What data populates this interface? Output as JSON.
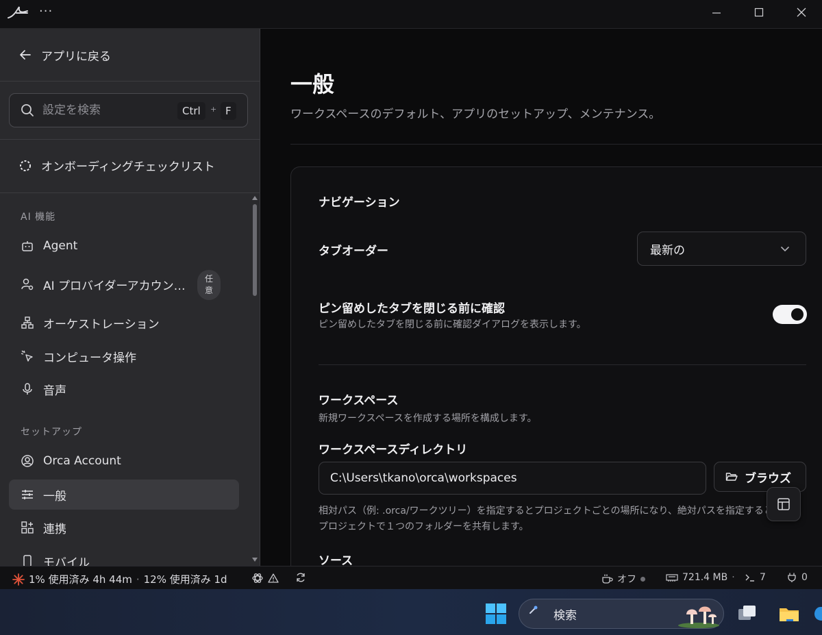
{
  "titlebar": {
    "menu_glyph": "···"
  },
  "sidebar": {
    "back_label": "アプリに戻る",
    "search": {
      "placeholder": "設定を検索",
      "key_ctrl": "Ctrl",
      "key_plus": "+",
      "key_f": "F"
    },
    "onboarding_label": "オンボーディングチェックリスト",
    "sections": [
      {
        "title": "AI 機能"
      },
      {
        "title": "セットアップ"
      }
    ],
    "items": [
      {
        "label": "Agent",
        "icon": "bot-icon"
      },
      {
        "label": "AI プロバイダーアカウン…",
        "icon": "user-gear-icon",
        "badge_line1": "任",
        "badge_line2": "意"
      },
      {
        "label": "オーケストレーション",
        "icon": "hierarchy-icon"
      },
      {
        "label": "コンピュータ操作",
        "icon": "cursor-click-icon"
      },
      {
        "label": "音声",
        "icon": "microphone-icon"
      },
      {
        "label": "Orca Account",
        "icon": "user-circle-icon"
      },
      {
        "label": "一般",
        "icon": "sliders-icon",
        "active": true
      },
      {
        "label": "連携",
        "icon": "grid-plus-icon"
      },
      {
        "label": "モバイル",
        "icon": "phone-icon"
      }
    ]
  },
  "main": {
    "title": "一般",
    "subtitle": "ワークスペースのデフォルト、アプリのセットアップ、メンテナンス。",
    "navigation": {
      "heading": "ナビゲーション",
      "tab_order_label": "タブオーダー",
      "tab_order_value": "最新の",
      "confirm_label": "ピン留めしたタブを閉じる前に確認",
      "confirm_desc": "ピン留めしたタブを閉じる前に確認ダイアログを表示します。",
      "confirm_enabled": true
    },
    "workspace": {
      "heading": "ワークスペース",
      "desc": "新規ワークスペースを作成する場所を構成します。",
      "dir_label": "ワークスペースディレクトリ",
      "dir_value": "C:\\Users\\tkano\\orca\\workspaces",
      "browse_label": "ブラウズ",
      "helper": "相対パス（例: .orca/ワークツリー）を指定するとプロジェクトごとの場所になり、絶対パスを指定すると全プロジェクトで１つのフォルダーを共有します。"
    },
    "source_heading": "ソース"
  },
  "statusbar": {
    "usage_primary": "1% 使用済み 4h 44m",
    "separator": "·",
    "usage_secondary": "12% 使用済み 1d",
    "caffeine": "オフ",
    "memory": "721.4 MB",
    "terminals": "7",
    "ports": "0"
  },
  "taskbar": {
    "search_label": "検索"
  },
  "colors": {
    "accent_sun": "#e0533a",
    "toggle_on": "#f4f4f6",
    "sidebar_bg": "#2a2a2d",
    "main_bg": "#0b0b0c"
  }
}
